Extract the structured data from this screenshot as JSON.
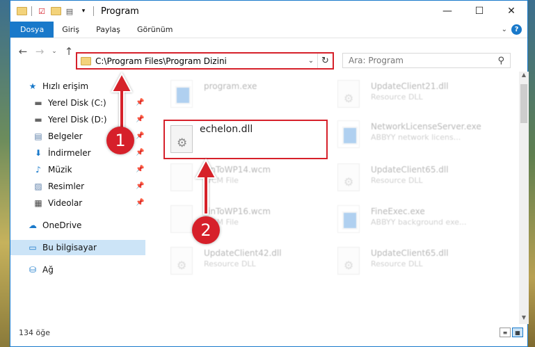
{
  "window": {
    "title": "Program"
  },
  "quick_access_toolbar": [
    "folder-icon",
    "properties-icon",
    "new-folder-icon",
    "customize-icon"
  ],
  "window_controls": {
    "minimize": "—",
    "maximize": "☐",
    "close": "✕"
  },
  "ribbon": {
    "tabs": [
      {
        "label": "Dosya",
        "active": true
      },
      {
        "label": "Giriş"
      },
      {
        "label": "Paylaş"
      },
      {
        "label": "Görünüm"
      }
    ],
    "help": "?"
  },
  "navigation": {
    "back": "←",
    "forward": "→",
    "recent": "⌄",
    "up": "↑",
    "address": "C:\\Program Files\\Program Dizini",
    "refresh": "↻",
    "dropdown": "⌄"
  },
  "search": {
    "placeholder": "Ara: Program",
    "icon": "⚲"
  },
  "sidebar": {
    "items": [
      {
        "label": "Hızlı erişim",
        "icon": "star-icon",
        "glyph": "★"
      },
      {
        "label": "Yerel Disk (C:)",
        "icon": "drive-icon",
        "glyph": "▬",
        "pinned": true
      },
      {
        "label": "Yerel Disk (D:)",
        "icon": "drive-icon",
        "glyph": "▬",
        "pinned": true
      },
      {
        "label": "Belgeler",
        "icon": "documents-icon",
        "glyph": "▤",
        "pinned": true
      },
      {
        "label": "İndirmeler",
        "icon": "download-icon",
        "glyph": "⬇",
        "pinned": true
      },
      {
        "label": "Müzik",
        "icon": "music-icon",
        "glyph": "♪",
        "pinned": true
      },
      {
        "label": "Resimler",
        "icon": "pictures-icon",
        "glyph": "▨",
        "pinned": true
      },
      {
        "label": "Videolar",
        "icon": "video-icon",
        "glyph": "▦",
        "pinned": true
      },
      {
        "label": "OneDrive",
        "icon": "cloud-icon",
        "glyph": "☁"
      },
      {
        "label": "Bu bilgisayar",
        "icon": "computer-icon",
        "glyph": "▭",
        "selected": true
      },
      {
        "label": "Ağ",
        "icon": "network-icon",
        "glyph": "⛁"
      }
    ],
    "pin_glyph": "📌"
  },
  "files": [
    {
      "name": "program.exe",
      "desc": "",
      "type": "exe"
    },
    {
      "name": "UpdateClient21.dll",
      "desc": "Resource DLL",
      "type": "dll"
    },
    {
      "name": "echelon.dll",
      "desc": "",
      "type": "dll",
      "highlighted": true
    },
    {
      "name": "NetworkLicenseServer.exe",
      "desc": "ABBYY network licens...",
      "type": "exe"
    },
    {
      "name": "FinToWP14.wcm",
      "desc": "WCM File",
      "type": "file"
    },
    {
      "name": "UpdateClient65.dll",
      "desc": "Resource DLL",
      "type": "dll"
    },
    {
      "name": "FinToWP16.wcm",
      "desc": "WCM File",
      "type": "file"
    },
    {
      "name": "FineExec.exe",
      "desc": "ABBYY background exe...",
      "type": "exe"
    },
    {
      "name": "UpdateClient42.dll",
      "desc": "Resource DLL",
      "type": "dll"
    },
    {
      "name": "UpdateClient65.dll",
      "desc": "Resource DLL",
      "type": "dll"
    }
  ],
  "annotations": [
    {
      "number": "1",
      "target": "address-bar"
    },
    {
      "number": "2",
      "target": "echelon.dll"
    }
  ],
  "status": {
    "count": "134 öğe"
  },
  "colors": {
    "accent": "#1979ca",
    "highlight": "#d6202a",
    "selected": "#cce4f7"
  }
}
